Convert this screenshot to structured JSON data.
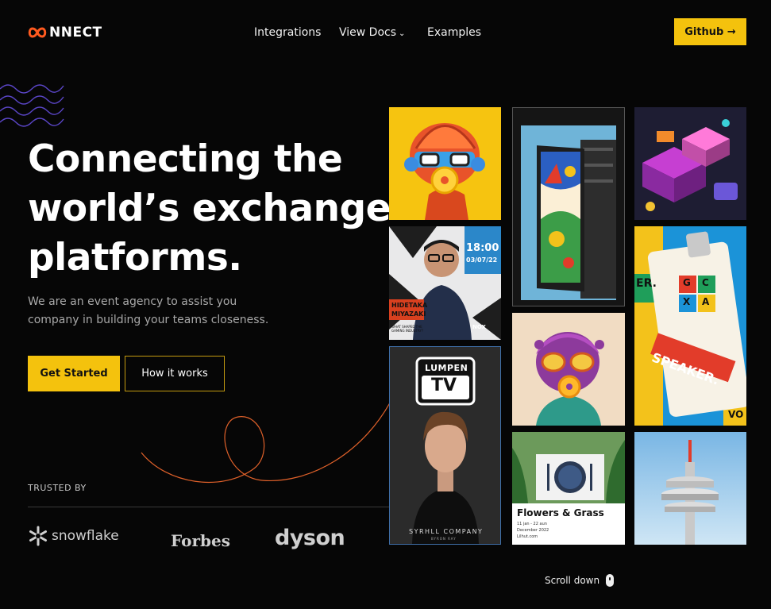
{
  "header": {
    "logo_text": "CONNECT",
    "logo_prefix": "C",
    "logo_rest": "NNECT",
    "nav": [
      {
        "label": "Integrations"
      },
      {
        "label": "View Docs",
        "has_dropdown": true
      },
      {
        "label": "Examples"
      }
    ],
    "github_label": "Github →"
  },
  "hero": {
    "title_lines": [
      "Connecting the",
      "world’s exchange",
      "platforms."
    ],
    "subtitle_lines": [
      "We are an event agency to assist you",
      "company in building your teams closeness."
    ],
    "primary_cta": "Get Started",
    "secondary_cta": "How it works"
  },
  "trusted": {
    "label": "TRUSTED BY",
    "brands": [
      "snowflake",
      "Forbes",
      "dyson"
    ]
  },
  "gallery": {
    "speaker_card": {
      "time": "18:00",
      "date": "03/07/22",
      "name_lines": [
        "HIDETAKA",
        "MIYAZAKI"
      ],
      "caption": "WHAT SHAPED THE GAMING INDUSTRY?",
      "brand": "NOX"
    },
    "tv_card": {
      "title_top": "LUMPEN",
      "title_bottom": "TV",
      "footer": "SYRHLL COMPANY",
      "footer_sub": "BYRON RAY"
    },
    "badge_card": {
      "letters": [
        "G",
        "C",
        "X",
        "A"
      ],
      "text": "SPEAKER.",
      "side_text": "ER.",
      "corner": "VO"
    },
    "event_card": {
      "title": "Flowers & Grass",
      "dates": "11 jan - 22 aun",
      "month": "December 2022",
      "site": "Lilhut.com"
    }
  },
  "scroll_label": "Scroll down",
  "colors": {
    "accent": "#f4c20d",
    "logo_orange": "#ff5a1f",
    "background": "#060606"
  }
}
